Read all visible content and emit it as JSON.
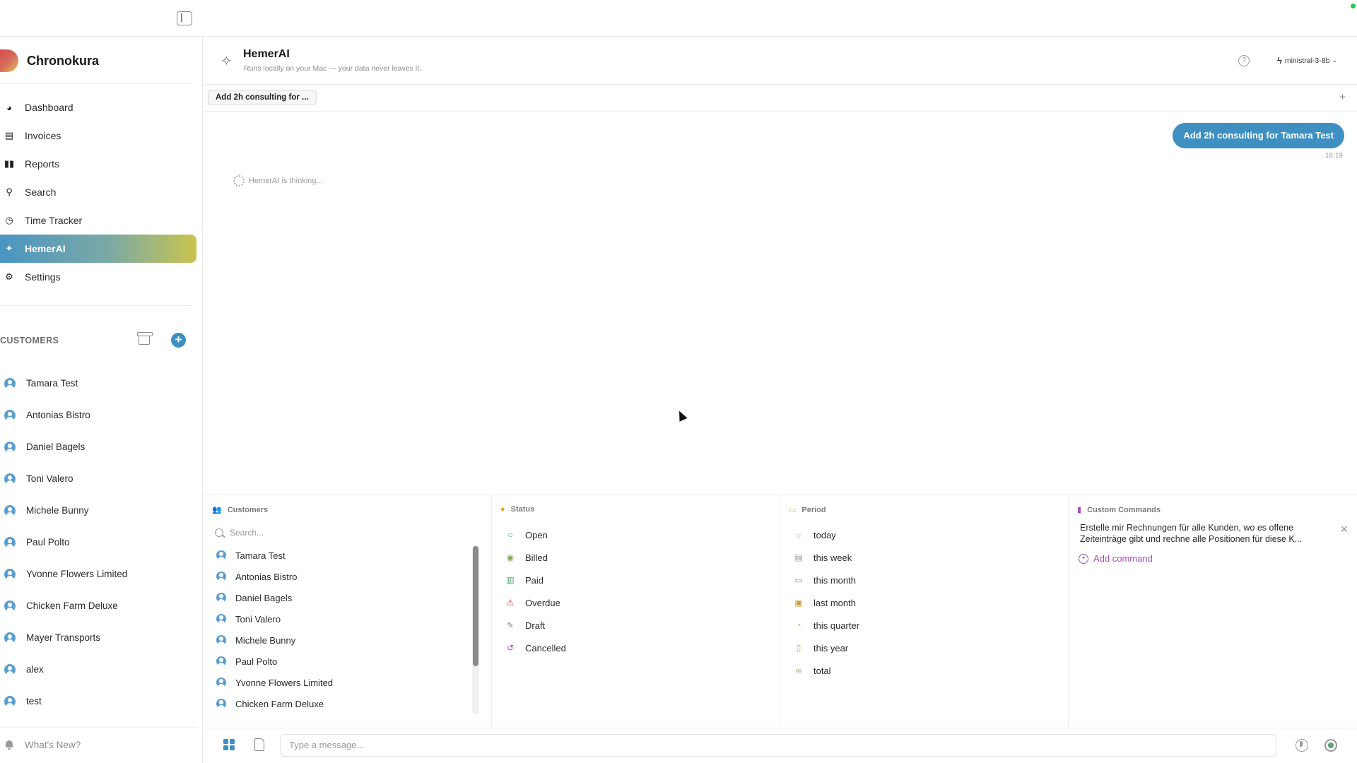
{
  "app": {
    "name": "Chronokura",
    "colors": {
      "accent": "#3e8fc2",
      "active_gradient": [
        "#4a95c2",
        "#c9c44f"
      ],
      "command_accent": "#a64bbd"
    }
  },
  "sidebar": {
    "nav": [
      {
        "label": "Dashboard",
        "icon": "pie-chart-icon"
      },
      {
        "label": "Invoices",
        "icon": "document-icon"
      },
      {
        "label": "Reports",
        "icon": "bar-chart-icon"
      },
      {
        "label": "Search",
        "icon": "search-icon"
      },
      {
        "label": "Time Tracker",
        "icon": "clock-icon"
      },
      {
        "label": "HemerAI",
        "icon": "sparkle-icon",
        "active": true
      },
      {
        "label": "Settings",
        "icon": "gear-icon"
      }
    ],
    "customers_title": "CUSTOMERS",
    "customers": [
      "Tamara Test",
      "Antonias Bistro",
      "Daniel Bagels",
      "Toni Valero",
      "Michele Bunny",
      "Paul Polto",
      "Yvonne Flowers Limited",
      "Chicken Farm Deluxe",
      "Mayer Transports",
      "alex",
      "test"
    ],
    "whats_new": "What's New?"
  },
  "header": {
    "title": "HemerAI",
    "subtitle": "Runs locally on your Mac — your data never leaves it.",
    "model": "ministral-3-8b"
  },
  "tabs": {
    "active": "Add 2h consulting for ..."
  },
  "chat": {
    "user_message": "Add 2h consulting for Tamara Test",
    "time": "16:19",
    "thinking": "HemerAI is thinking..."
  },
  "panel": {
    "customers": {
      "title": "Customers",
      "search_placeholder": "Search...",
      "items": [
        "Tamara Test",
        "Antonias Bistro",
        "Daniel Bagels",
        "Toni Valero",
        "Michele Bunny",
        "Paul Polto",
        "Yvonne Flowers Limited",
        "Chicken Farm Deluxe"
      ]
    },
    "status": {
      "title": "Status",
      "items": [
        {
          "label": "Open",
          "icon": "circle-icon"
        },
        {
          "label": "Billed",
          "icon": "check-circle-icon"
        },
        {
          "label": "Paid",
          "icon": "money-icon"
        },
        {
          "label": "Overdue",
          "icon": "warning-icon"
        },
        {
          "label": "Draft",
          "icon": "draft-icon"
        },
        {
          "label": "Cancelled",
          "icon": "undo-icon"
        }
      ]
    },
    "period": {
      "title": "Period",
      "items": [
        {
          "label": "today",
          "icon": "sun-icon"
        },
        {
          "label": "this week",
          "icon": "calendar-week-icon"
        },
        {
          "label": "this month",
          "icon": "calendar-icon"
        },
        {
          "label": "last month",
          "icon": "calendar-back-icon"
        },
        {
          "label": "this quarter",
          "icon": "quarter-icon"
        },
        {
          "label": "this year",
          "icon": "calendar-year-icon"
        },
        {
          "label": "total",
          "icon": "infinity-icon"
        }
      ]
    },
    "commands": {
      "title": "Custom Commands",
      "items": [
        "Erstelle mir Rechnungen für alle Kunden, wo es offene Zeiteinträge gibt und rechne alle Positionen für diese K..."
      ],
      "add_label": "Add command"
    }
  },
  "composer": {
    "placeholder": "Type a message..."
  }
}
